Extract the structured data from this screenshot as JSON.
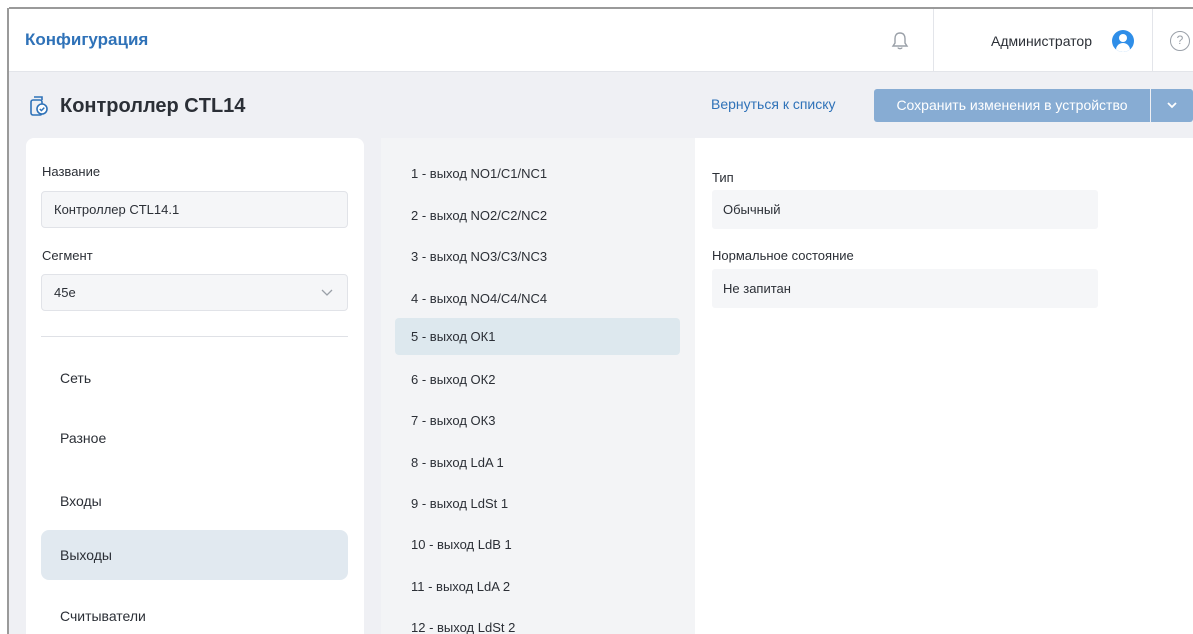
{
  "header": {
    "app_title": "Конфигурация",
    "user_name": "Администратор",
    "help_glyph": "?"
  },
  "page": {
    "title": "Контроллер CTL14",
    "back_link": "Вернуться к списку",
    "save_button": "Сохранить изменения в устройство"
  },
  "left": {
    "name_label": "Название",
    "name_value": "Контроллер CTL14.1",
    "segment_label": "Сегмент",
    "segment_value": "45e",
    "nav": [
      {
        "label": "Сеть",
        "active": false
      },
      {
        "label": "Разное",
        "active": false
      },
      {
        "label": "Входы",
        "active": false
      },
      {
        "label": "Выходы",
        "active": true
      },
      {
        "label": "Считыватели",
        "active": false
      }
    ]
  },
  "outputs": [
    {
      "label": "1 - выход NO1/C1/NC1",
      "active": false
    },
    {
      "label": "2 - выход NO2/C2/NC2",
      "active": false
    },
    {
      "label": "3 - выход NO3/C3/NC3",
      "active": false
    },
    {
      "label": "4 - выход NO4/C4/NC4",
      "active": false
    },
    {
      "label": "5 - выход ОК1",
      "active": true
    },
    {
      "label": "6 - выход ОК2",
      "active": false
    },
    {
      "label": "7 - выход ОК3",
      "active": false
    },
    {
      "label": "8 - выход LdA 1",
      "active": false
    },
    {
      "label": "9 - выход LdSt 1",
      "active": false
    },
    {
      "label": "10 - выход LdB 1",
      "active": false
    },
    {
      "label": "11 - выход LdA 2",
      "active": false
    },
    {
      "label": "12 - выход LdSt 2",
      "active": false
    }
  ],
  "detail": {
    "type_label": "Тип",
    "type_value": "Обычный",
    "state_label": "Нормальное состояние",
    "state_value": "Не запитан"
  },
  "icons": {
    "bell": "bell-icon",
    "avatar": "user-avatar-icon",
    "help": "help-icon",
    "controller": "controller-icon",
    "dropdown": "chevron-down-icon"
  },
  "colors": {
    "accent": "#2f72b8",
    "button": "#87acd3",
    "active_nav": "#e1e9f0",
    "active_output": "#dde8ee"
  }
}
